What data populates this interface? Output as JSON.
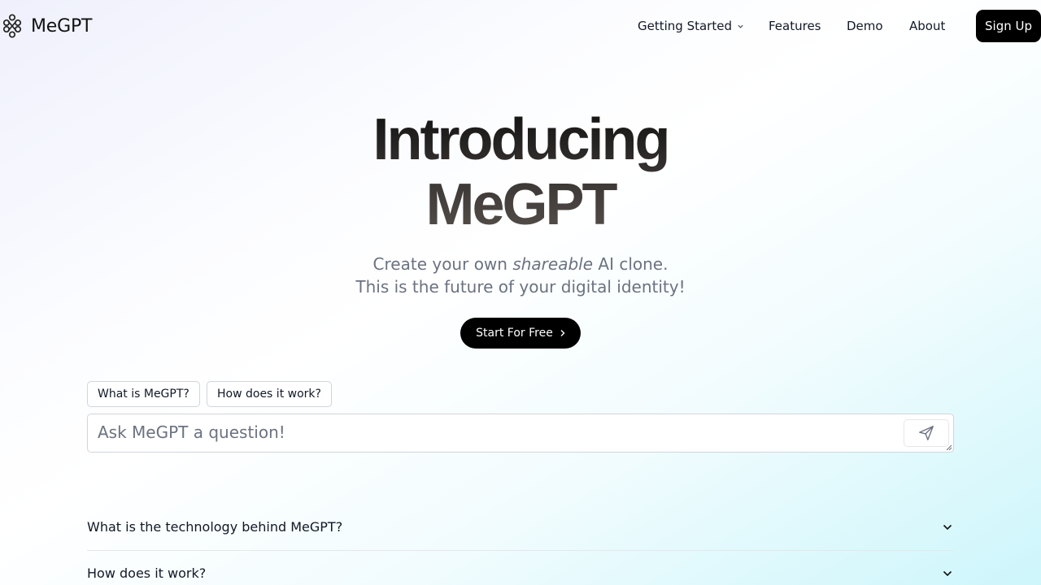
{
  "header": {
    "logo_text": "MeGPT",
    "logo_icon": "knot-icon",
    "nav": [
      {
        "label": "Getting Started",
        "has_dropdown": true
      },
      {
        "label": "Features"
      },
      {
        "label": "Demo"
      },
      {
        "label": "About"
      }
    ],
    "signup_label": "Sign Up"
  },
  "hero": {
    "title_line1": "Introducing",
    "title_line2": "MeGPT",
    "subtitle_prefix": "Create your own ",
    "subtitle_emphasis": "shareable",
    "subtitle_suffix": " AI clone.",
    "subtitle_line2": "This is the future of your digital identity!",
    "cta_label": "Start For Free"
  },
  "chat": {
    "suggestions": [
      "What is MeGPT?",
      "How does it work?"
    ],
    "placeholder": "Ask MeGPT a question!",
    "value": ""
  },
  "faq": [
    {
      "question": "What is the technology behind MeGPT?"
    },
    {
      "question": "How does it work?"
    }
  ],
  "colors": {
    "button_bg": "#000000",
    "muted_text": "#6b7280",
    "gradient_end": "#cdf6fb"
  }
}
